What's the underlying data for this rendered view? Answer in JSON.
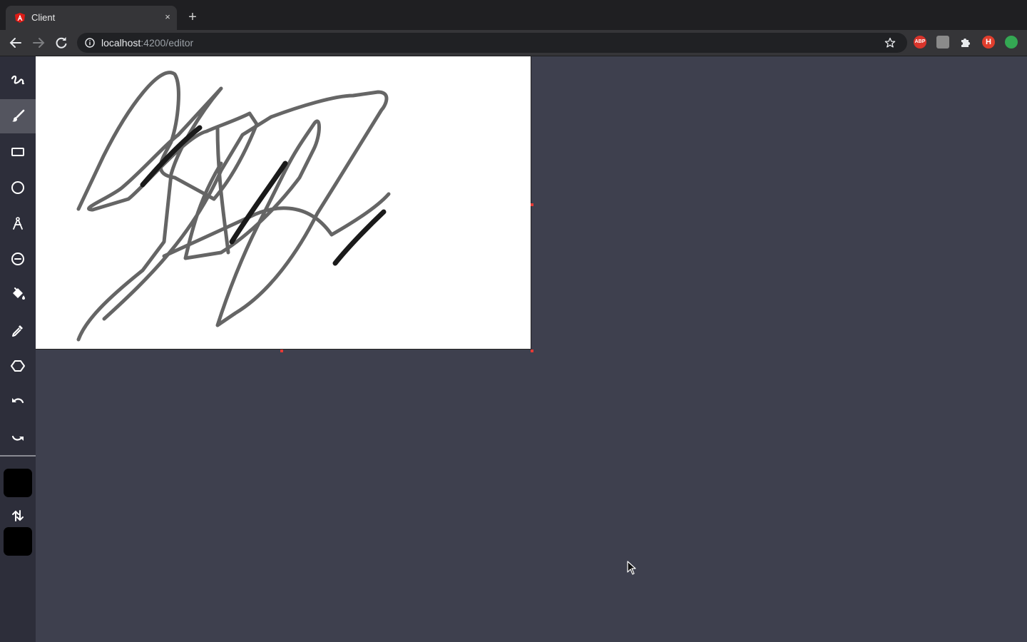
{
  "browser": {
    "tab_title": "Client",
    "tab_close": "×",
    "new_tab": "+",
    "url_host": "localhost",
    "url_path": ":4200/editor",
    "extensions": [
      {
        "name": "adblock-extension",
        "label": "ABP",
        "color": "#d9342b"
      },
      {
        "name": "translate-extension",
        "label": "",
        "color": "#8a8a8a"
      },
      {
        "name": "extensions-puzzle",
        "label": "",
        "color": ""
      },
      {
        "name": "profile-avatar",
        "label": "H",
        "color": "#e03e2d"
      },
      {
        "name": "green-extension",
        "label": "",
        "color": "#34a853"
      }
    ]
  },
  "toolbar": {
    "tools": [
      {
        "name": "freehand-tool",
        "icon": "squiggle-icon",
        "active": false
      },
      {
        "name": "brush-tool",
        "icon": "brush-icon",
        "active": true
      },
      {
        "name": "rectangle-tool",
        "icon": "rectangle-icon",
        "active": false
      },
      {
        "name": "ellipse-tool",
        "icon": "circle-icon",
        "active": false
      },
      {
        "name": "pen-tool",
        "icon": "compass-icon",
        "active": false
      },
      {
        "name": "eraser-tool",
        "icon": "minus-circle-icon",
        "active": false
      },
      {
        "name": "fill-tool",
        "icon": "paint-bucket-icon",
        "active": false
      },
      {
        "name": "eyedropper-tool",
        "icon": "eyedropper-icon",
        "active": false
      },
      {
        "name": "polygon-tool",
        "icon": "hexagon-icon",
        "active": false
      },
      {
        "name": "undo-button",
        "icon": "undo-icon",
        "active": false
      },
      {
        "name": "redo-button",
        "icon": "redo-icon",
        "active": false
      }
    ],
    "primary_color": "#000000",
    "secondary_color": "#000000"
  },
  "colors": {
    "background": "#3e404e",
    "sidebar": "#2d2e3a",
    "active_tool": "#54555f",
    "handle": "#e53935"
  }
}
